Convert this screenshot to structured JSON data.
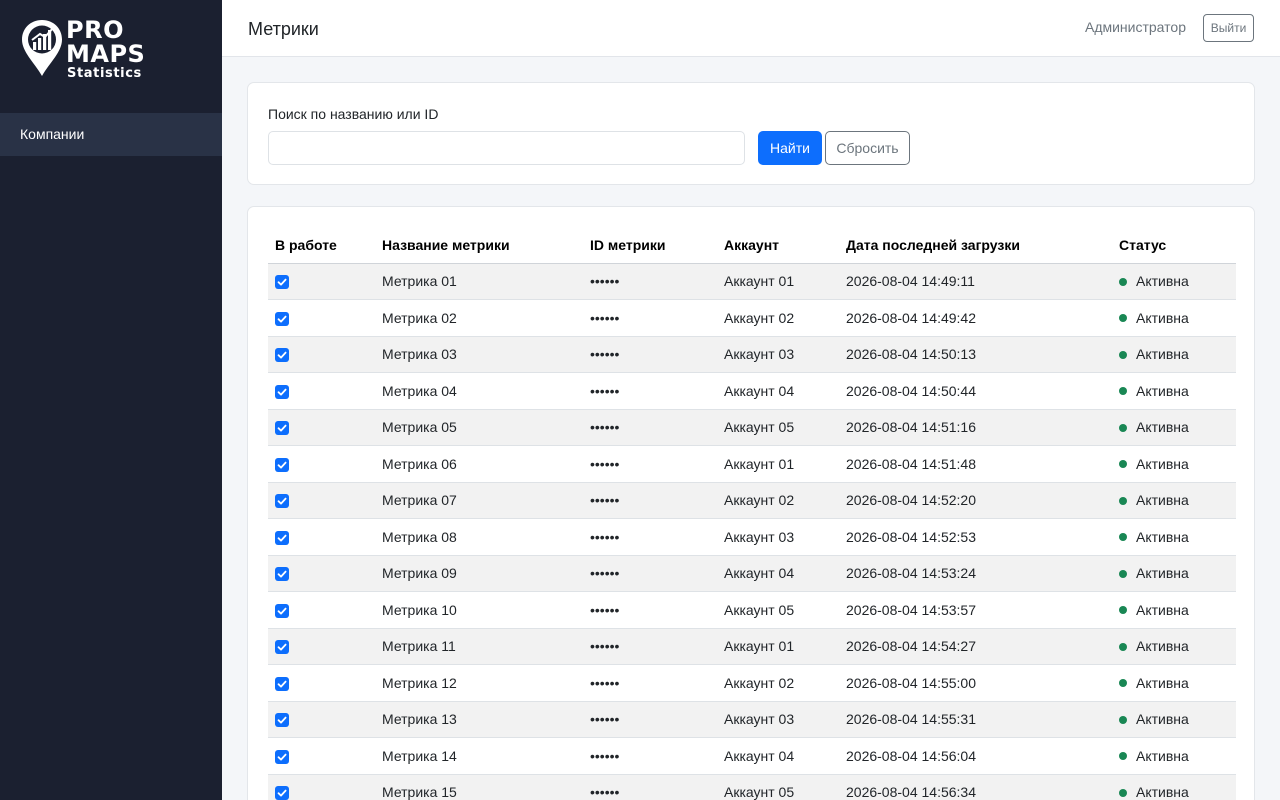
{
  "sidebar": {
    "logo": {
      "line1": "PRO",
      "line2": "MAPS",
      "line3": "Statistics"
    },
    "items": [
      {
        "label": "Компании"
      }
    ]
  },
  "header": {
    "title": "Метрики",
    "user": "Администратор",
    "logout_label": "Выйти"
  },
  "search": {
    "label": "Поиск по названию или ID",
    "value": "",
    "placeholder": "",
    "find_label": "Найти",
    "reset_label": "Сбросить"
  },
  "table": {
    "columns": [
      "В работе",
      "Название метрики",
      "ID метрики",
      "Аккаунт",
      "Дата последней загрузки",
      "Статус"
    ],
    "rows": [
      {
        "in_work": true,
        "name": "Метрика 01",
        "id": "••••••",
        "account": "Аккаунт 01",
        "date": "2026-08-04 14:49:11",
        "status": "Активна"
      },
      {
        "in_work": true,
        "name": "Метрика 02",
        "id": "••••••",
        "account": "Аккаунт 02",
        "date": "2026-08-04 14:49:42",
        "status": "Активна"
      },
      {
        "in_work": true,
        "name": "Метрика 03",
        "id": "••••••",
        "account": "Аккаунт 03",
        "date": "2026-08-04 14:50:13",
        "status": "Активна"
      },
      {
        "in_work": true,
        "name": "Метрика 04",
        "id": "••••••",
        "account": "Аккаунт 04",
        "date": "2026-08-04 14:50:44",
        "status": "Активна"
      },
      {
        "in_work": true,
        "name": "Метрика 05",
        "id": "••••••",
        "account": "Аккаунт 05",
        "date": "2026-08-04 14:51:16",
        "status": "Активна"
      },
      {
        "in_work": true,
        "name": "Метрика 06",
        "id": "••••••",
        "account": "Аккаунт 01",
        "date": "2026-08-04 14:51:48",
        "status": "Активна"
      },
      {
        "in_work": true,
        "name": "Метрика 07",
        "id": "••••••",
        "account": "Аккаунт 02",
        "date": "2026-08-04 14:52:20",
        "status": "Активна"
      },
      {
        "in_work": true,
        "name": "Метрика 08",
        "id": "••••••",
        "account": "Аккаунт 03",
        "date": "2026-08-04 14:52:53",
        "status": "Активна"
      },
      {
        "in_work": true,
        "name": "Метрика 09",
        "id": "••••••",
        "account": "Аккаунт 04",
        "date": "2026-08-04 14:53:24",
        "status": "Активна"
      },
      {
        "in_work": true,
        "name": "Метрика 10",
        "id": "••••••",
        "account": "Аккаунт 05",
        "date": "2026-08-04 14:53:57",
        "status": "Активна"
      },
      {
        "in_work": true,
        "name": "Метрика 11",
        "id": "••••••",
        "account": "Аккаунт 01",
        "date": "2026-08-04 14:54:27",
        "status": "Активна"
      },
      {
        "in_work": true,
        "name": "Метрика 12",
        "id": "••••••",
        "account": "Аккаунт 02",
        "date": "2026-08-04 14:55:00",
        "status": "Активна"
      },
      {
        "in_work": true,
        "name": "Метрика 13",
        "id": "••••••",
        "account": "Аккаунт 03",
        "date": "2026-08-04 14:55:31",
        "status": "Активна"
      },
      {
        "in_work": true,
        "name": "Метрика 14",
        "id": "••••••",
        "account": "Аккаунт 04",
        "date": "2026-08-04 14:56:04",
        "status": "Активна"
      },
      {
        "in_work": true,
        "name": "Метрика 15",
        "id": "••••••",
        "account": "Аккаунт 05",
        "date": "2026-08-04 14:56:34",
        "status": "Активна"
      }
    ]
  },
  "colors": {
    "sidebar_bg": "#1b2030",
    "sidebar_active": "#293246",
    "primary": "#0d6efd",
    "status_active": "#198754"
  },
  "icons": {
    "logo": "map-pin-chart-icon",
    "checkbox": "checkbox-checked-icon",
    "status": "status-dot-icon"
  }
}
